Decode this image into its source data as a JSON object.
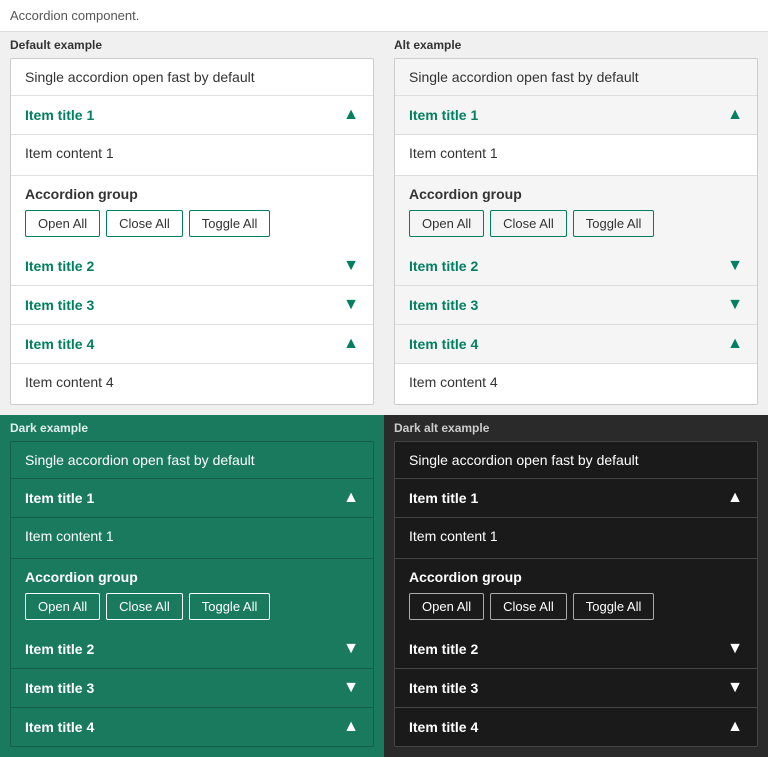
{
  "page": {
    "description": "Accordion component."
  },
  "sections": {
    "default_label": "Default example",
    "alt_label": "Alt example",
    "dark_label": "Dark example",
    "dark_alt_label": "Dark alt example"
  },
  "accordion": {
    "banner": "Single accordion open fast by default",
    "group_label": "Accordion group",
    "btn_open": "Open All",
    "btn_close": "Close All",
    "btn_toggle": "Toggle All",
    "items": [
      {
        "title": "Item title 1",
        "content": "Item content 1",
        "open": true,
        "chevron_up": "▲",
        "chevron_down": "▼"
      },
      {
        "title": "Item title 2",
        "content": "",
        "open": false,
        "chevron_up": "▲",
        "chevron_down": "▼"
      },
      {
        "title": "Item title 3",
        "content": "",
        "open": false,
        "chevron_up": "▲",
        "chevron_down": "▼"
      },
      {
        "title": "Item title 4",
        "content": "Item content 4",
        "open": true,
        "chevron_up": "▲",
        "chevron_down": "▼"
      }
    ],
    "single_items_dark_partial": [
      {
        "title": "Item title 1",
        "content": "Item content 1",
        "open": true
      },
      {
        "title": "Item title 2",
        "content": "",
        "open": false
      },
      {
        "title": "Item title 3",
        "content": "",
        "open": false
      },
      {
        "title": "Item title 4",
        "content": "",
        "open": false,
        "partial": true
      }
    ]
  }
}
